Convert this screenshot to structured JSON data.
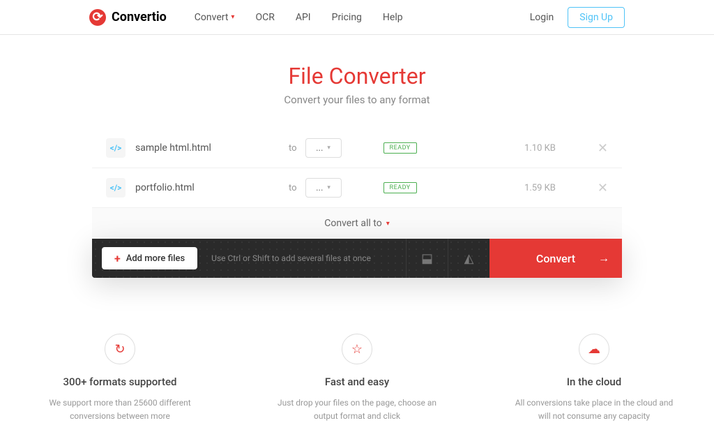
{
  "brand": "Convertio",
  "nav": {
    "convert": "Convert",
    "ocr": "OCR",
    "api": "API",
    "pricing": "Pricing",
    "help": "Help"
  },
  "auth": {
    "login": "Login",
    "signup": "Sign Up"
  },
  "hero": {
    "title": "File Converter",
    "subtitle": "Convert your files to any format"
  },
  "files": [
    {
      "name": "sample html.html",
      "to": "to",
      "format": "...",
      "status": "READY",
      "size": "1.10 KB"
    },
    {
      "name": "portfolio.html",
      "to": "to",
      "format": "...",
      "status": "READY",
      "size": "1.59 KB"
    }
  ],
  "convert_all": "Convert all to",
  "actions": {
    "add": "Add more files",
    "hint": "Use Ctrl or Shift to add several files at once",
    "convert": "Convert"
  },
  "features": [
    {
      "icon": "↻",
      "title": "300+ formats supported",
      "desc": "We support more than 25600 different conversions between more"
    },
    {
      "icon": "☆",
      "title": "Fast and easy",
      "desc": "Just drop your files on the page, choose an output format and click"
    },
    {
      "icon": "☁",
      "title": "In the cloud",
      "desc": "All conversions take place in the cloud and will not consume any capacity"
    }
  ]
}
